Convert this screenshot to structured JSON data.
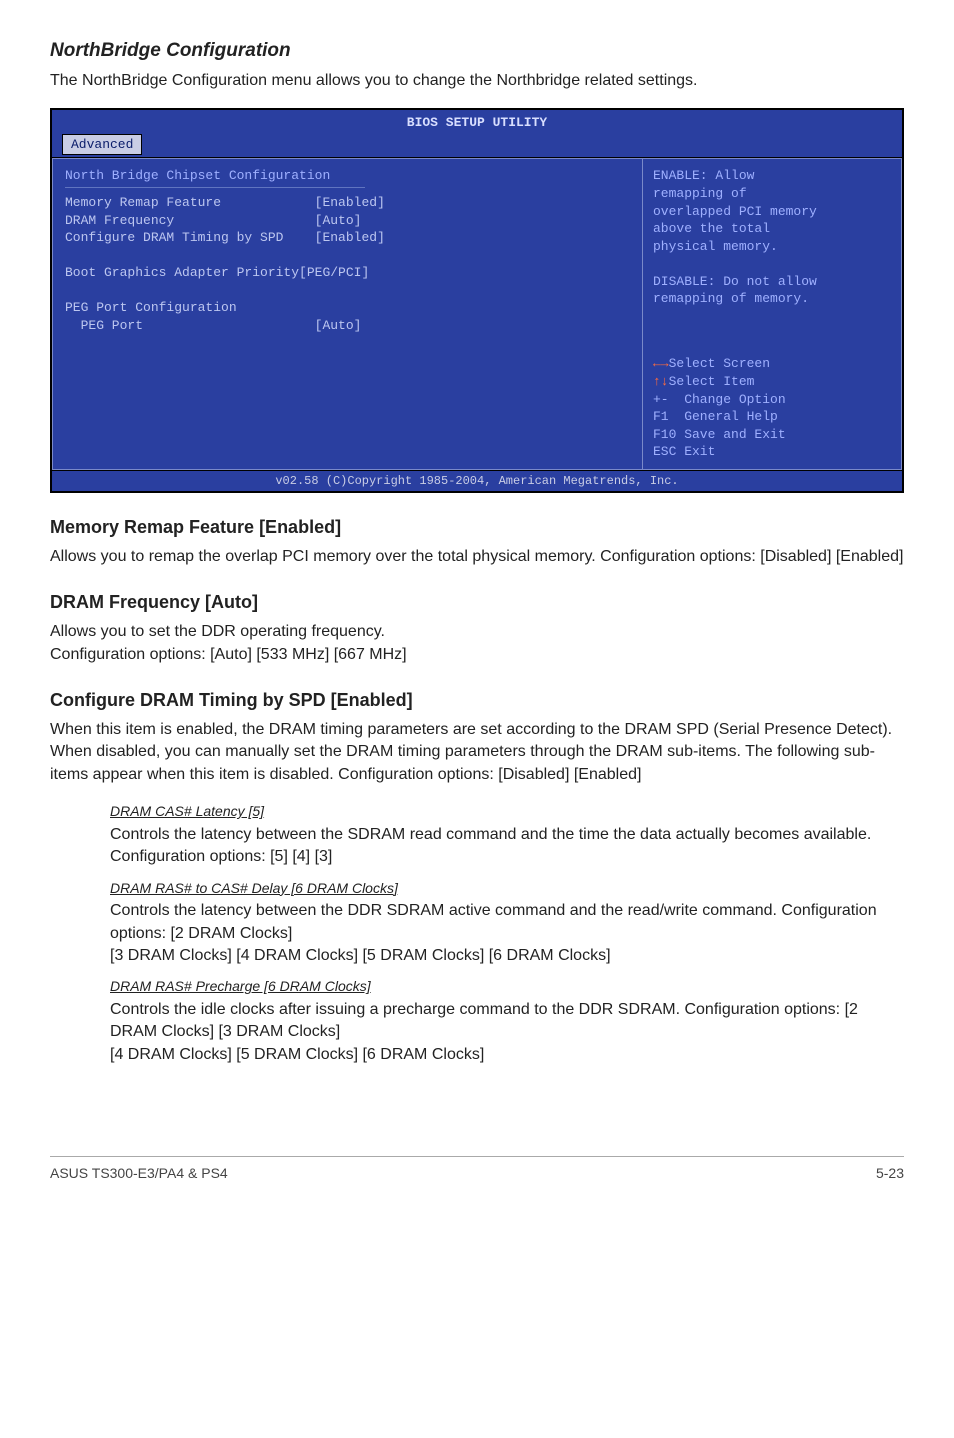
{
  "section1": {
    "title": "NorthBridge Configuration",
    "body": "The NorthBridge Configuration menu allows you to change the Northbridge related settings."
  },
  "bios": {
    "title": "BIOS SETUP UTILITY",
    "tab": "Advanced",
    "heading": "North Bridge Chipset Configuration",
    "rows": {
      "r1l": "Memory Remap Feature",
      "r1v": "[Enabled]",
      "r2l": "DRAM Frequency",
      "r2v": "[Auto]",
      "r3l": "Configure DRAM Timing by SPD",
      "r3v": "[Enabled]",
      "r4l": "Boot Graphics Adapter Priority[PEG/PCI]",
      "r5l": "PEG Port Configuration",
      "r6l": "  PEG Port",
      "r6v": "[Auto]"
    },
    "help": "ENABLE: Allow\nremapping of\noverlapped PCI memory\nabove the total\nphysical memory.\n\nDISABLE: Do not allow\nremapping of memory.",
    "keys": {
      "k1": "Select Screen",
      "k2": "Select Item",
      "k3": "+-  Change Option",
      "k4": "F1  General Help",
      "k5": "F10 Save and Exit",
      "k6": "ESC Exit"
    },
    "footer": "v02.58 (C)Copyright 1985-2004, American Megatrends, Inc."
  },
  "section2": {
    "title": "Memory Remap Feature [Enabled]",
    "body": "Allows you to remap the overlap PCI memory over the total physical memory. Configuration options: [Disabled] [Enabled]"
  },
  "section3": {
    "title": "DRAM Frequency [Auto]",
    "body": "Allows you to set the DDR operating frequency.\nConfiguration options: [Auto] [533 MHz] [667 MHz]"
  },
  "section4": {
    "title": "Configure DRAM Timing by SPD [Enabled]",
    "body": "When this item is enabled, the DRAM timing parameters are set according to the DRAM SPD (Serial Presence Detect). When disabled, you can manually set the DRAM timing parameters through the DRAM sub-items. The following sub-items appear when this item is disabled. Configuration options: [Disabled] [Enabled]",
    "sub1h": "DRAM CAS# Latency [5]",
    "sub1": "Controls the latency between the SDRAM read command and the time the data actually becomes available. Configuration options: [5] [4] [3]",
    "sub2h": "DRAM RAS# to CAS# Delay [6 DRAM Clocks]",
    "sub2": "Controls the latency between the DDR SDRAM active command and the read/write command. Configuration options: [2 DRAM Clocks]\n[3 DRAM Clocks] [4 DRAM Clocks] [5 DRAM Clocks] [6 DRAM Clocks]",
    "sub3h": "DRAM RAS# Precharge [6 DRAM Clocks]",
    "sub3": "Controls the idle clocks after issuing a precharge command to the DDR SDRAM. Configuration options: [2 DRAM Clocks] [3 DRAM Clocks]\n[4 DRAM Clocks] [5 DRAM Clocks] [6 DRAM Clocks]"
  },
  "footer": {
    "left": "ASUS TS300-E3/PA4 & PS4",
    "right": "5-23"
  }
}
